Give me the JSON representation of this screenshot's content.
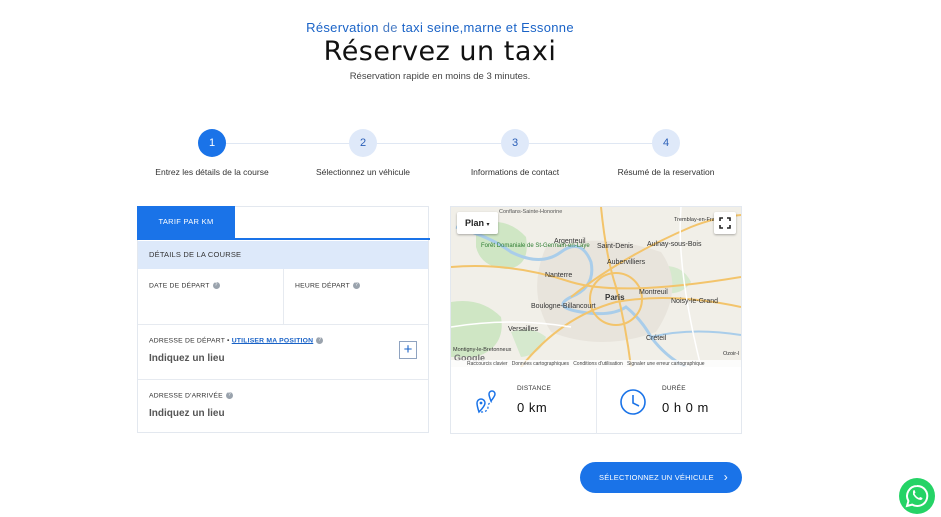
{
  "header": {
    "subtitle_part1": "Réservation",
    "subtitle_part2": "de",
    "subtitle_part3": "taxi seine,marne et Essonne",
    "title": "Réservez un taxi",
    "tagline": "Réservation rapide en moins de 3 minutes."
  },
  "steps": [
    {
      "number": "1",
      "label": "Entrez les détails de la course",
      "active": true
    },
    {
      "number": "2",
      "label": "Sélectionnez un véhicule",
      "active": false
    },
    {
      "number": "3",
      "label": "Informations de contact",
      "active": false
    },
    {
      "number": "4",
      "label": "Résumé de la reservation",
      "active": false
    }
  ],
  "form": {
    "tab_label": "TARIF PAR KM",
    "section_title": "DÉTAILS DE LA COURSE",
    "date_label": "DATE DE DÉPART",
    "time_label": "HEURE DÉPART",
    "pickup_label": "ADRESSE DE DÉPART",
    "pickup_separator": "•",
    "use_position_link": "UTILISER MA POSITION",
    "pickup_placeholder": "Indiquez un lieu",
    "dropoff_label": "ADRESSE D'ARRIVÉE",
    "dropoff_placeholder": "Indiquez un lieu",
    "help_glyph": "?",
    "add_glyph": "+"
  },
  "map": {
    "type_button": "Plan",
    "places": [
      "Conflans-Sainte-Honorine",
      "Argenteuil",
      "Forêt Domaniale de St-Germain-en-Laye",
      "Saint-Denis",
      "Aulnay-sous-Bois",
      "Tremblay-en-France",
      "Aubervilliers",
      "Nanterre",
      "Paris",
      "Boulogne-Billancourt",
      "Montreuil",
      "Noisy-le-Grand",
      "Versailles",
      "Créteil",
      "Montigny-le-Bretonneux",
      "Ozoir-l"
    ],
    "logo": "Google",
    "footer": [
      "Raccourcis clavier",
      "Données cartographiques",
      "Conditions d'utilisation",
      "Signaler une erreur cartographique"
    ]
  },
  "trip": {
    "distance_label": "DISTANCE",
    "distance_value": "0 km",
    "duration_label": "DURÉE",
    "duration_value": "0 h 0 m"
  },
  "actions": {
    "next_label": "SÉLECTIONNEZ UN VÉHICULE",
    "next_chevron": "›"
  },
  "colors": {
    "accent": "#1a73e8",
    "whatsapp": "#25d366",
    "section_bg": "#dde9fa"
  }
}
